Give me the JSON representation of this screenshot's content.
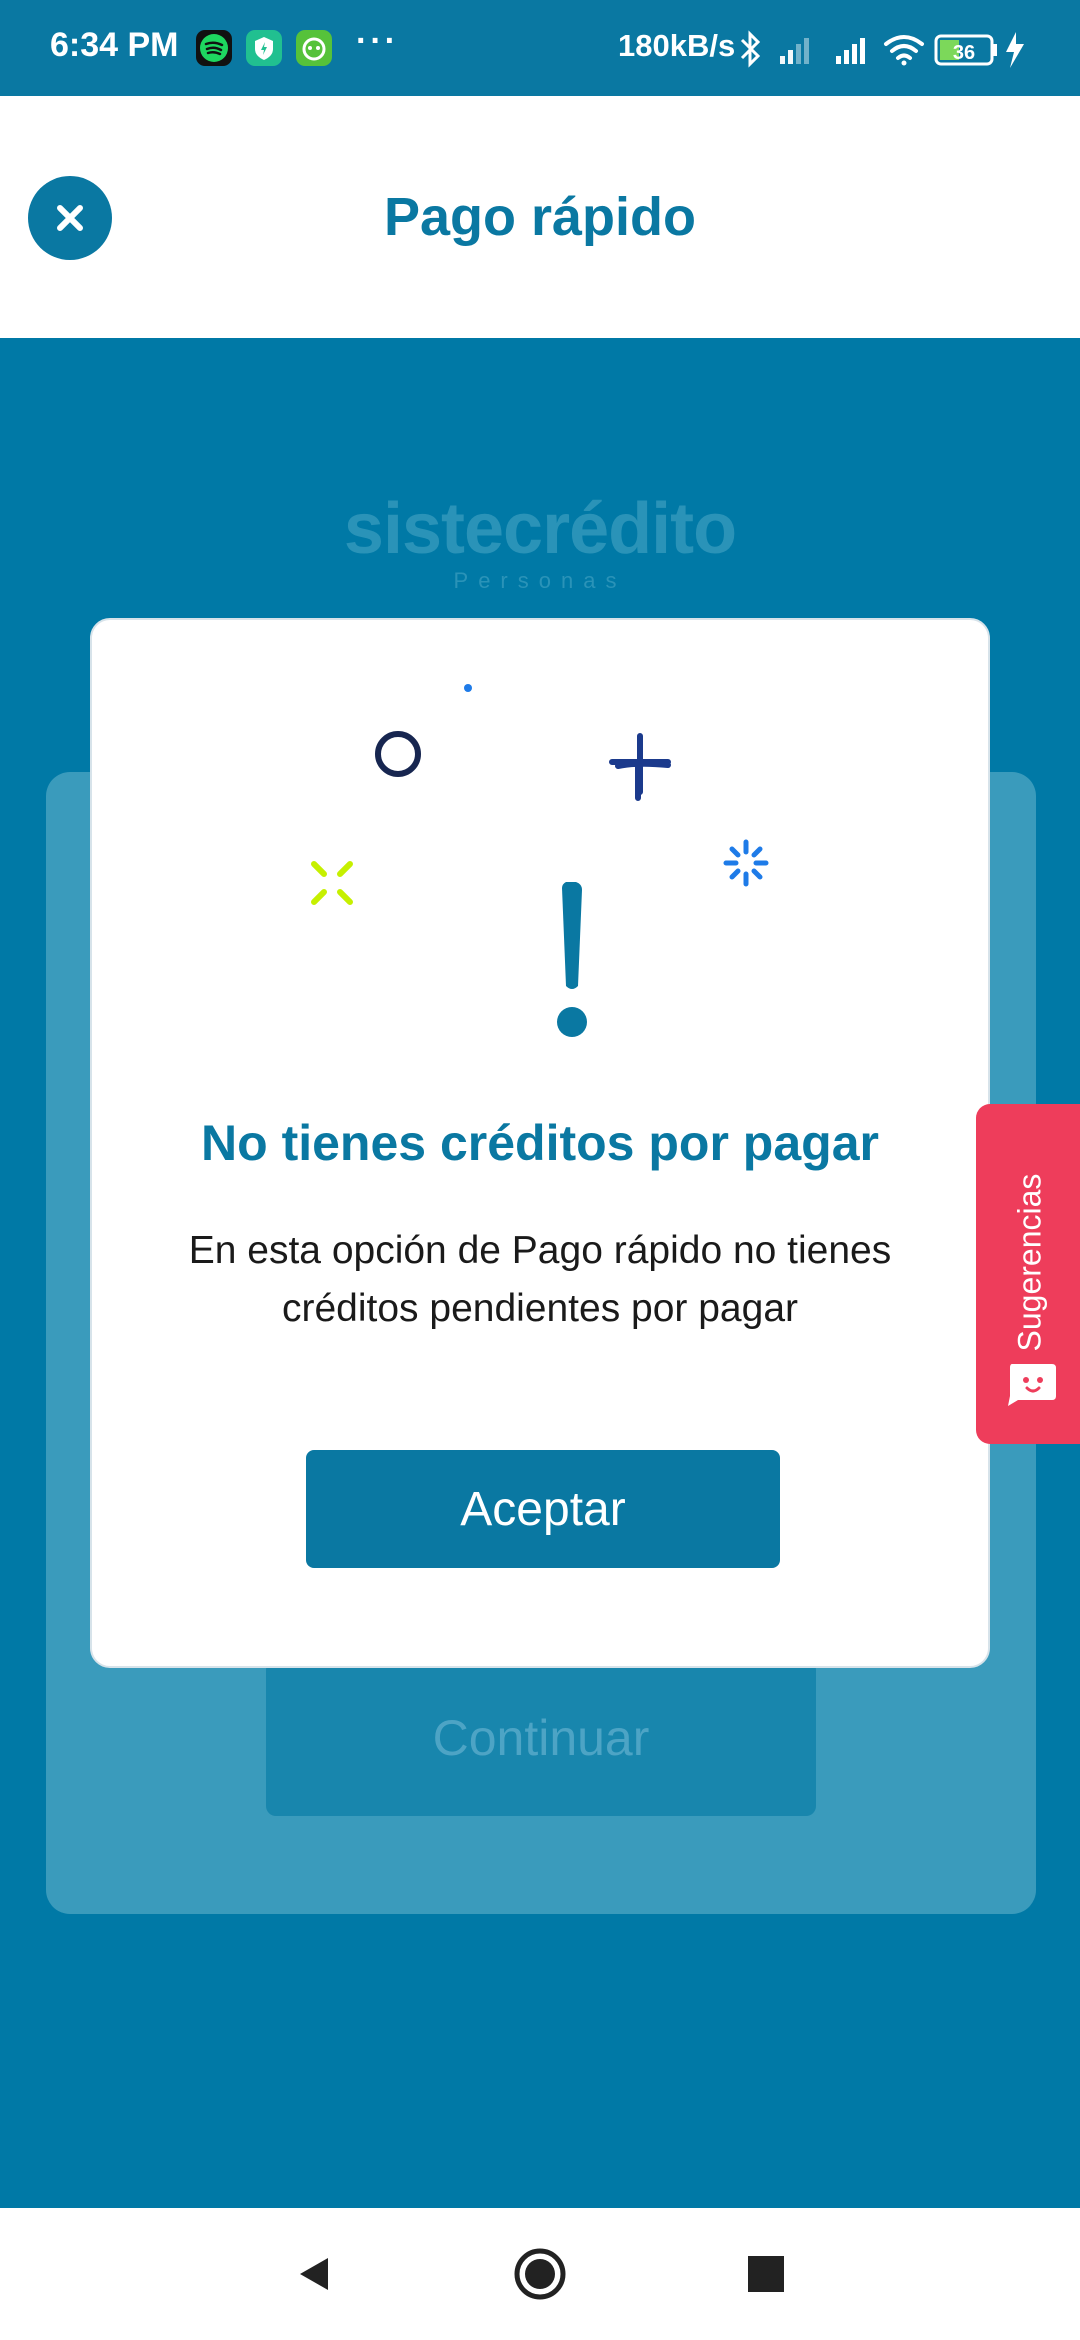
{
  "status_bar": {
    "time": "6:34 PM",
    "dots": "···",
    "network_speed": "180kB/s",
    "battery": "36",
    "icons": [
      "spotify-icon",
      "vpn-shield-icon",
      "app-icon",
      "bluetooth-icon",
      "signal-icon",
      "signal-icon",
      "wifi-icon",
      "battery-icon",
      "charging-icon"
    ]
  },
  "header": {
    "title": "Pago rápido",
    "close_icon": "close-icon"
  },
  "background": {
    "logo": "sistecrédito",
    "logo_sub": "Personas",
    "continue_label": "Continuar"
  },
  "modal": {
    "title": "No tienes créditos por pagar",
    "body": "En esta opción de Pago rápido no tienes créditos pendientes por pagar",
    "accept_label": "Aceptar",
    "icon": "exclamation-icon"
  },
  "suggestions": {
    "label": "Sugerencias",
    "icon": "chat-face-icon"
  },
  "nav": {
    "items": [
      "back-icon",
      "home-icon",
      "recents-icon"
    ]
  },
  "colors": {
    "primary": "#0A78A2",
    "background": "#0079A6",
    "suggestions": "#EE3D5B",
    "accent_green": "#C6F000",
    "accent_blue": "#1E7BE8",
    "accent_navy": "#1B3A8C"
  }
}
